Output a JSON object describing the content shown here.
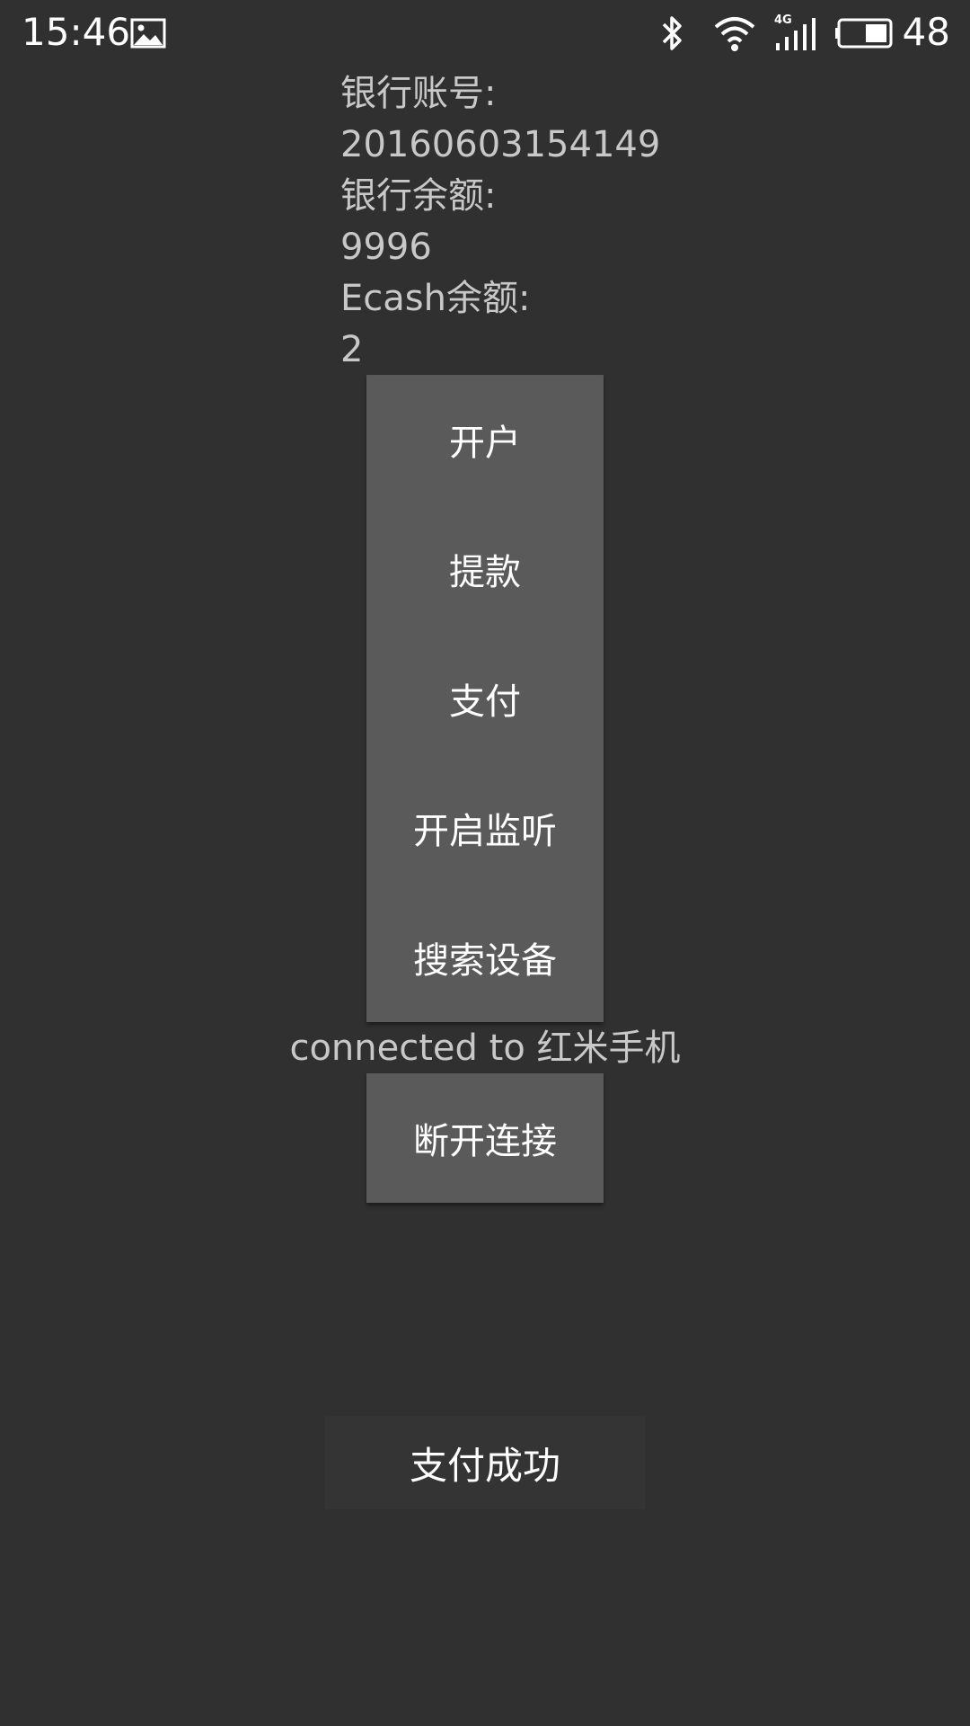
{
  "status_bar": {
    "time": "15:46",
    "network_type": "4G",
    "battery_level": "48",
    "icons": [
      "image-icon",
      "bluetooth-icon",
      "wifi-icon",
      "signal-icon",
      "battery-icon"
    ]
  },
  "account": {
    "bank_account_label": "银行账号:",
    "bank_account_value": "20160603154149",
    "bank_balance_label": "银行余额:",
    "bank_balance_value": "9996",
    "ecash_balance_label": "Ecash余额:",
    "ecash_balance_value": "2"
  },
  "buttons": {
    "open_account": "开户",
    "withdraw": "提款",
    "pay": "支付",
    "start_listening": "开启监听",
    "search_devices": "搜索设备",
    "disconnect": "断开连接"
  },
  "connection": {
    "status_text": "connected to 红米手机"
  },
  "toast": {
    "message": "支付成功"
  },
  "colors": {
    "background": "#303030",
    "button": "#5a5a5a",
    "text_secondary": "#c8c8c8",
    "toast": "#343434"
  }
}
